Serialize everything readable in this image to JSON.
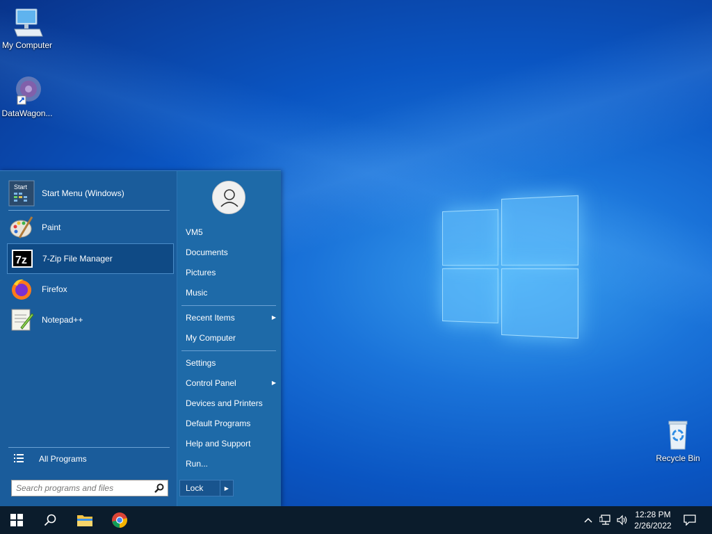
{
  "desktop": {
    "icons": [
      {
        "label": "My Computer",
        "icon": "computer-icon"
      },
      {
        "label": "DataWagon...",
        "icon": "datawagon-shortcut-icon"
      },
      {
        "label": "Recycle Bin",
        "icon": "recycle-bin-icon"
      }
    ]
  },
  "start_menu": {
    "pinned": [
      {
        "label": "Start Menu (Windows)",
        "icon": "start-menu-icon"
      },
      {
        "label": "Paint",
        "icon": "paint-palette-icon"
      },
      {
        "label": "7-Zip File Manager",
        "icon": "7zip-icon"
      },
      {
        "label": "Firefox",
        "icon": "firefox-icon"
      },
      {
        "label": "Notepad++",
        "icon": "notepadpp-icon"
      }
    ],
    "all_programs": "All Programs",
    "search_placeholder": "Search programs and files",
    "user_name": "VM5",
    "right_links": [
      {
        "label": "Documents"
      },
      {
        "label": "Pictures"
      },
      {
        "label": "Music"
      },
      {
        "label": "Recent Items",
        "submenu": true
      },
      {
        "label": "My Computer"
      },
      {
        "label": "Settings"
      },
      {
        "label": "Control Panel",
        "submenu": true
      },
      {
        "label": "Devices and Printers"
      },
      {
        "label": "Default Programs"
      },
      {
        "label": "Help and Support"
      },
      {
        "label": "Run..."
      }
    ],
    "lock_label": "Lock"
  },
  "taskbar": {
    "time": "12:28 PM",
    "date": "2/26/2022",
    "icons": [
      "windows-start-icon",
      "search-icon",
      "file-explorer-icon",
      "chrome-icon"
    ],
    "tray_icons": [
      "chevron-up-icon",
      "network-icon",
      "volume-icon",
      "notification-icon"
    ]
  },
  "colors": {
    "start_menu_left": "#1a5c9b",
    "start_menu_right": "#1e6aa8",
    "taskbar": "#0b1c2c",
    "selected_item": "#0f4a85"
  }
}
